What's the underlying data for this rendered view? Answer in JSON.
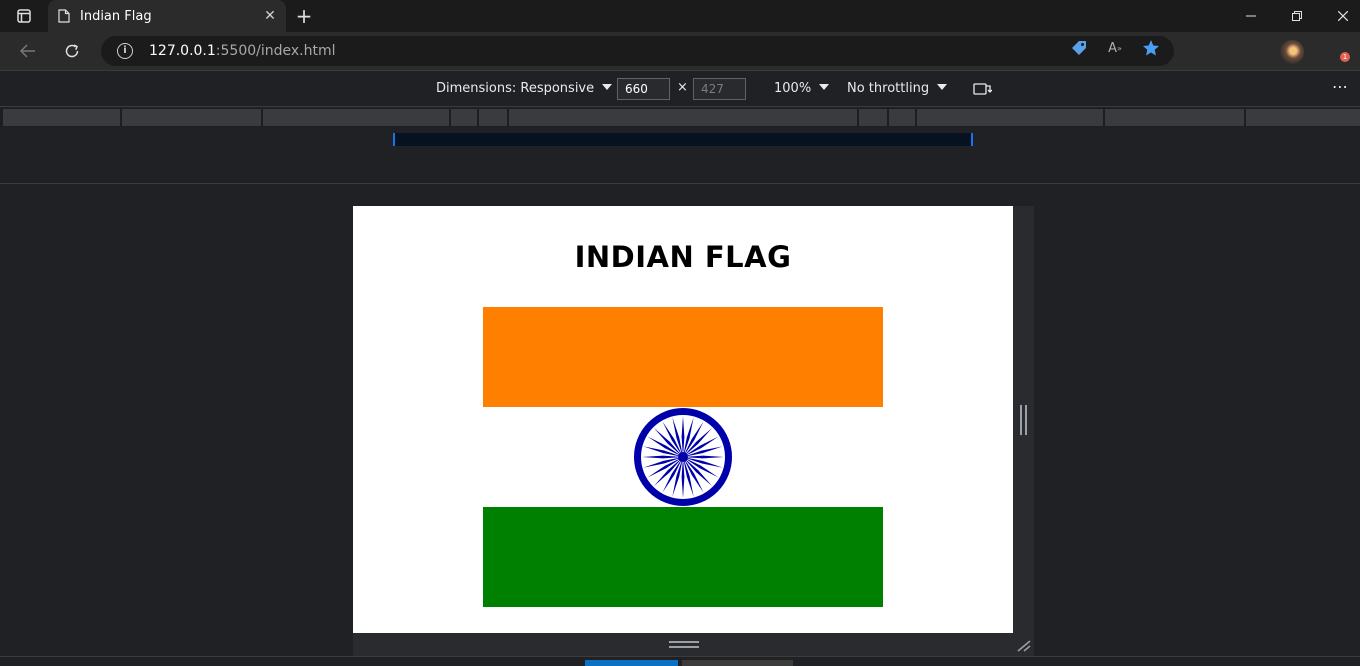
{
  "browser": {
    "tab_title": "Indian Flag",
    "url_host": "127.0.0.1",
    "url_path": ":5500/index.html",
    "new_tab_symbol": "+",
    "badge_count": "1"
  },
  "devtools": {
    "dimensions_label": "Dimensions: Responsive",
    "width": "660",
    "height_placeholder": "427",
    "times_symbol": "×",
    "zoom": "100%",
    "throttling": "No throttling",
    "more_label": "⋯"
  },
  "page": {
    "heading": "INDIAN FLAG",
    "colors": {
      "saffron": "#ff8000",
      "white": "#ffffff",
      "green": "#008000",
      "chakra": "#0000aa"
    },
    "chakra_spokes": 24
  }
}
